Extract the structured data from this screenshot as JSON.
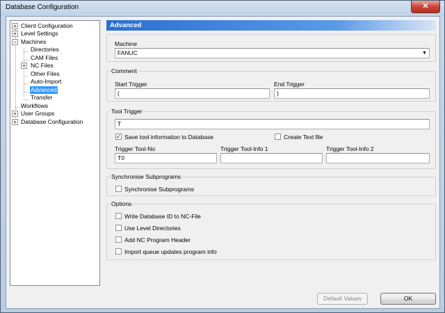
{
  "window": {
    "title": "Database Configuration",
    "close_glyph": "✕"
  },
  "tree": {
    "items": [
      {
        "label": "Client Configuration",
        "expander": "+"
      },
      {
        "label": "Level Settings",
        "expander": "+"
      },
      {
        "label": "Machines",
        "expander": "−"
      },
      {
        "label": "Directories"
      },
      {
        "label": "CAM Files"
      },
      {
        "label": "NC Files",
        "expander": "+"
      },
      {
        "label": "Other Files"
      },
      {
        "label": "Auto-Import"
      },
      {
        "label": "Advanced"
      },
      {
        "label": "Transfer"
      },
      {
        "label": "Workflows"
      },
      {
        "label": "User Groups",
        "expander": "+"
      },
      {
        "label": "Database Configuration",
        "expander": "+"
      }
    ]
  },
  "panel": {
    "title": "Advanced"
  },
  "machine": {
    "label": "Machine",
    "value": "FANUC"
  },
  "comment": {
    "title": "Comment",
    "start_label": "Start Trigger",
    "start_value": "(",
    "end_label": "End Trigger",
    "end_value": ")"
  },
  "tool_trigger": {
    "title": "Tool Trigger",
    "value": "T",
    "save_label": "Save tool information to Database",
    "save_checked": true,
    "create_text_label": "Create Text file",
    "create_text_checked": false,
    "tool_no_label": "Trigger Tool-No",
    "tool_no_value": "T0",
    "info1_label": "Trigger Tool-Info 1",
    "info1_value": "",
    "info2_label": "Trigger Tool-Info 2",
    "info2_value": ""
  },
  "sync": {
    "title": "Synchronise Subprograms",
    "checkbox_label": "Synchronise Subprograms",
    "checked": false
  },
  "options": {
    "title": "Options",
    "items": [
      {
        "label": "Write Database ID to NC-File",
        "checked": false
      },
      {
        "label": "Use Level Directories",
        "checked": false
      },
      {
        "label": "Add NC Program Header",
        "checked": false
      },
      {
        "label": "Import queue updates program info",
        "checked": false
      }
    ]
  },
  "buttons": {
    "default_values": "Default Values",
    "ok": "OK"
  },
  "glyphs": {
    "check": "✓",
    "dropdown": "▼"
  }
}
